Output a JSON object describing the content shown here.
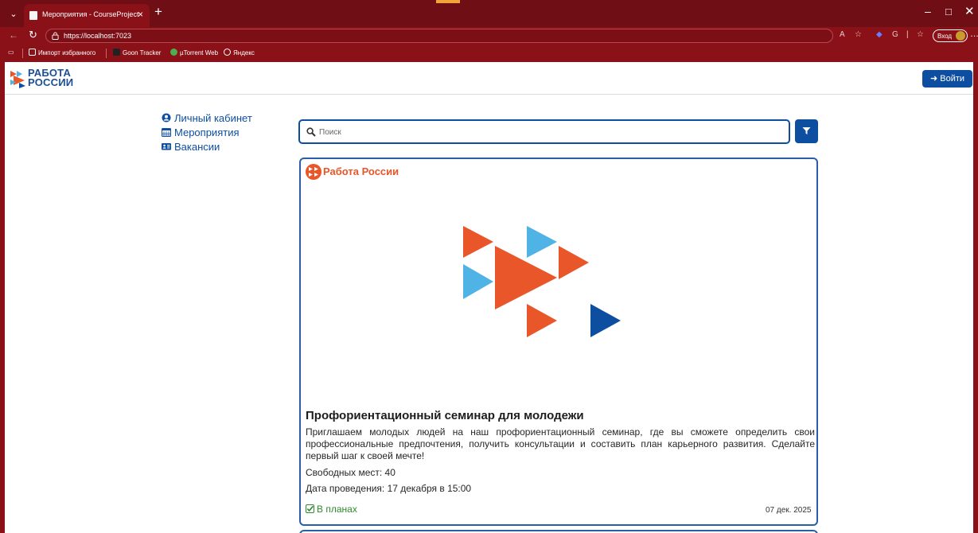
{
  "browser": {
    "tab_title": "Мероприятия - CourseProject",
    "tab_close": "×",
    "new_tab": "+",
    "url": "https://localhost:7023",
    "profile_label": "Вход",
    "bookmarks": [
      "Импорт избранного",
      "Goon Tracker",
      "µTorrent Web",
      "Яндекс"
    ],
    "window_controls": {
      "minimize": "–",
      "maximize": "□",
      "close": "✕"
    }
  },
  "header": {
    "logo_line1": "РАБОТА",
    "logo_line2": "РОССИИ",
    "login_label": "Войти",
    "login_icon": "sign-in-icon"
  },
  "sidebar": {
    "items": [
      {
        "label": "Личный кабинет",
        "icon": "user-circle-icon"
      },
      {
        "label": "Мероприятия",
        "icon": "calendar-icon"
      },
      {
        "label": "Вакансии",
        "icon": "id-card-icon"
      }
    ]
  },
  "search": {
    "placeholder": "Поиск",
    "value": "",
    "filter_icon": "filter-icon"
  },
  "events": [
    {
      "brand": "Работа России",
      "title": "Профориентационный семинар для молодежи",
      "description": "Приглашаем молодых людей на наш профориентационный семинар, где вы сможете определить свои профессиональные предпочтения, получить консультации и составить план карьерного развития. Сделайте первый шаг к своей мечте!",
      "seats": "Свободных мест: 40",
      "date": "Дата проведения: 17 декабря в 15:00",
      "status": "В планах",
      "posted": "07 дек. 2025"
    }
  ],
  "colors": {
    "brand_blue": "#0d4ea1",
    "brand_orange": "#e8562a",
    "brand_light_blue": "#4fb3e6",
    "browser_red": "#8b1118",
    "status_green": "#2e8b2e"
  }
}
